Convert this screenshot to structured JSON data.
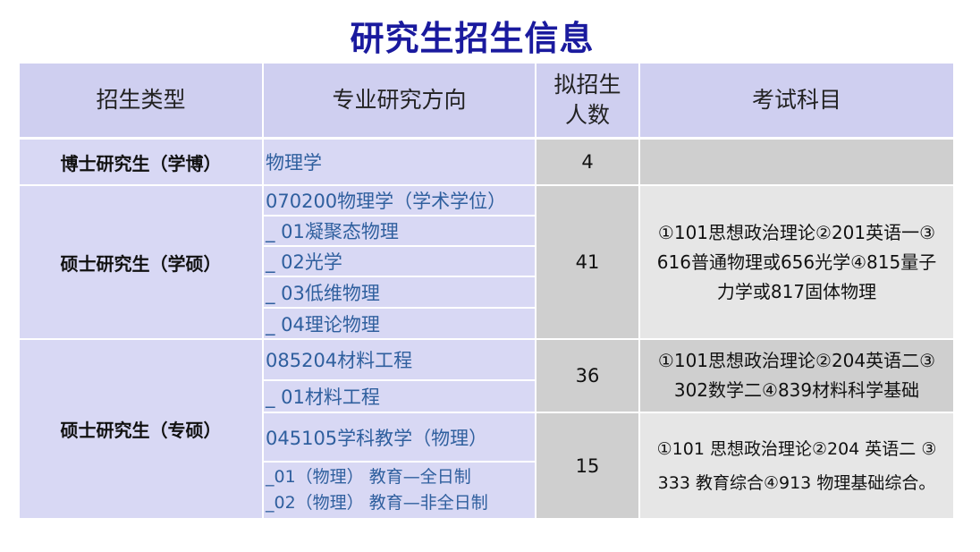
{
  "title": "研究生招生信息",
  "header": {
    "type": "招生类型",
    "direction": "专业研究方向",
    "quota_line1": "拟招生",
    "quota_line2": "人数",
    "subjects": "考试科目"
  },
  "rows": {
    "phd": {
      "type": "博士研究生（学博）",
      "direction": "物理学",
      "quota": "4",
      "subjects": ""
    },
    "master_academic": {
      "type": "硕士研究生（学硕）",
      "directions": [
        "070200物理学（学术学位）",
        "_ 01凝聚态物理",
        "_ 02光学",
        "_ 03低维物理",
        "_ 04理论物理"
      ],
      "quota": "41",
      "subjects_line1": "①101思想政治理论②201英语一③",
      "subjects_line2": "616普通物理或656光学④815量子",
      "subjects_line3": "力学或817固体物理"
    },
    "master_professional": {
      "type": "硕士研究生（专硕）",
      "group1": {
        "directions": [
          "085204材料工程",
          "_ 01材料工程"
        ],
        "quota": "36",
        "subjects_line1": "①101思想政治理论②204英语二③",
        "subjects_line2": "302数学二④839材料科学基础"
      },
      "group2": {
        "directions": [
          "045105学科教学（物理）",
          "_01（物理） 教育—全日制",
          "_02（物理） 教育—非全日制"
        ],
        "quota": "15",
        "subjects_line1": "①101 思想政治理论②204 英语二 ③",
        "subjects_line2": "333 教育综合④913 物理基础综合。"
      }
    }
  }
}
